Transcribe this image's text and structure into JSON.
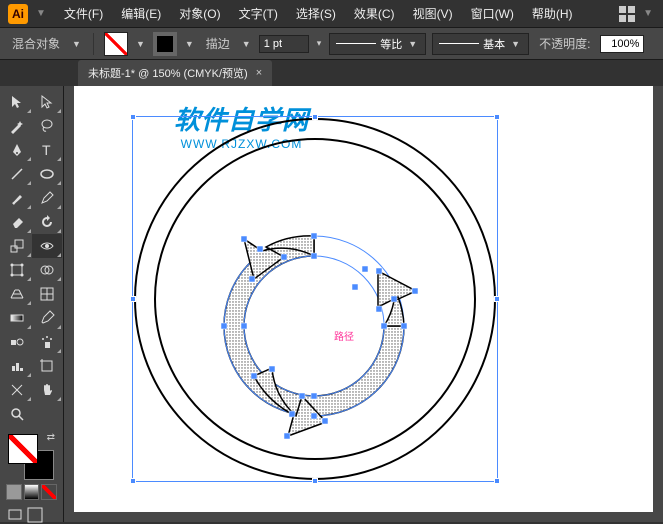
{
  "app": {
    "icon_label": "Ai"
  },
  "menus": {
    "file": "文件(F)",
    "edit": "编辑(E)",
    "object": "对象(O)",
    "type": "文字(T)",
    "select": "选择(S)",
    "effect": "效果(C)",
    "view": "视图(V)",
    "window": "窗口(W)",
    "help": "帮助(H)"
  },
  "control": {
    "tool_label": "混合对象",
    "stroke_label": "描边",
    "stroke_value": "1 pt",
    "uniform_label": "等比",
    "style_label": "基本",
    "opacity_label": "不透明度:",
    "opacity_value": "100%"
  },
  "tab": {
    "title": "未标题-1* @ 150% (CMYK/预览)",
    "close": "×"
  },
  "canvas": {
    "watermark_cn": "软件自学网",
    "watermark_en": "WWW.RJZXW.COM",
    "pink_label": "路径"
  }
}
